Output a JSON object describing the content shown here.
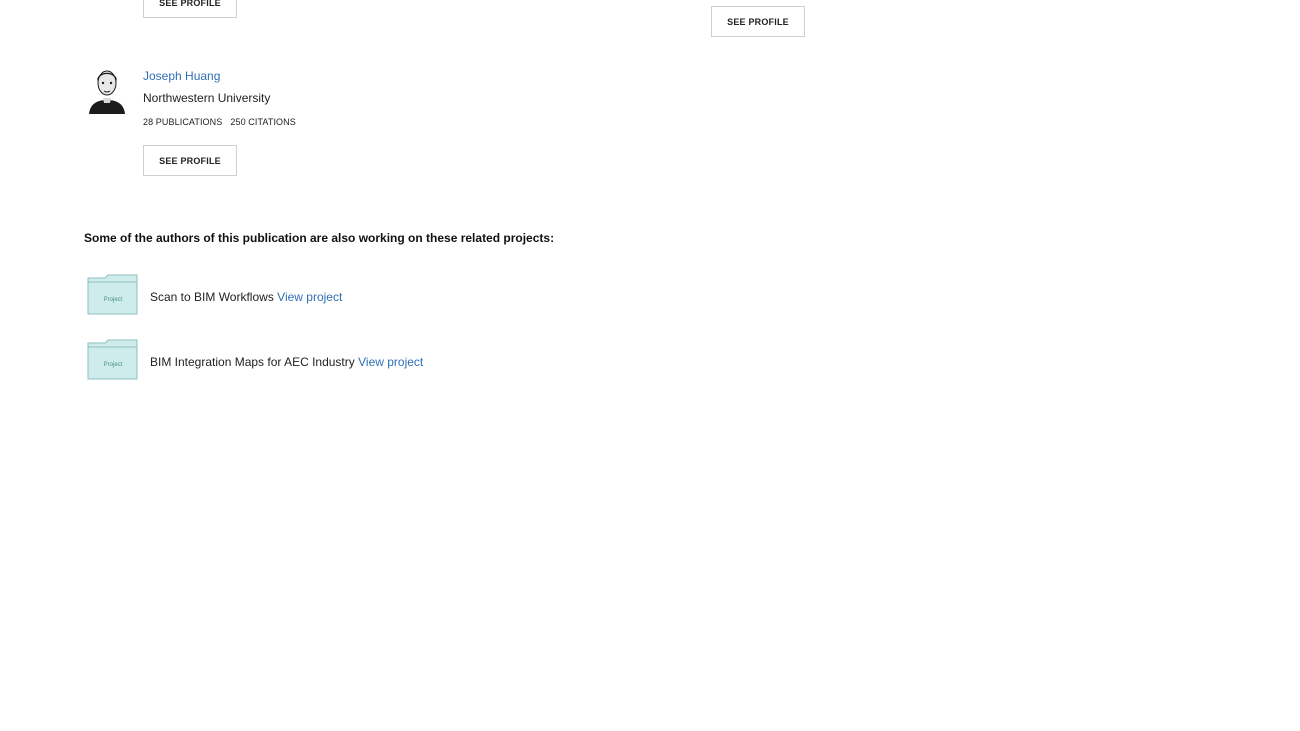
{
  "profile_buttons": {
    "top_left_label": "SEE PROFILE",
    "top_right_label": "SEE PROFILE"
  },
  "author": {
    "name": "Joseph Huang",
    "institution": "Northwestern University",
    "publications": "28 PUBLICATIONS",
    "citations": "250 CITATIONS",
    "button_label": "SEE PROFILE"
  },
  "related": {
    "heading": "Some of the authors of this publication are also working on these related projects:",
    "projects": [
      {
        "title": "Scan to BIM Workflows",
        "link_label": "View project",
        "folder_label": "Project"
      },
      {
        "title": "BIM Integration Maps for AEC Industry",
        "link_label": "View project",
        "folder_label": "Project"
      }
    ]
  },
  "colors": {
    "link": "#2f6fb5",
    "folder_fill": "#cdeceb",
    "folder_stroke": "#8fbfbd"
  }
}
